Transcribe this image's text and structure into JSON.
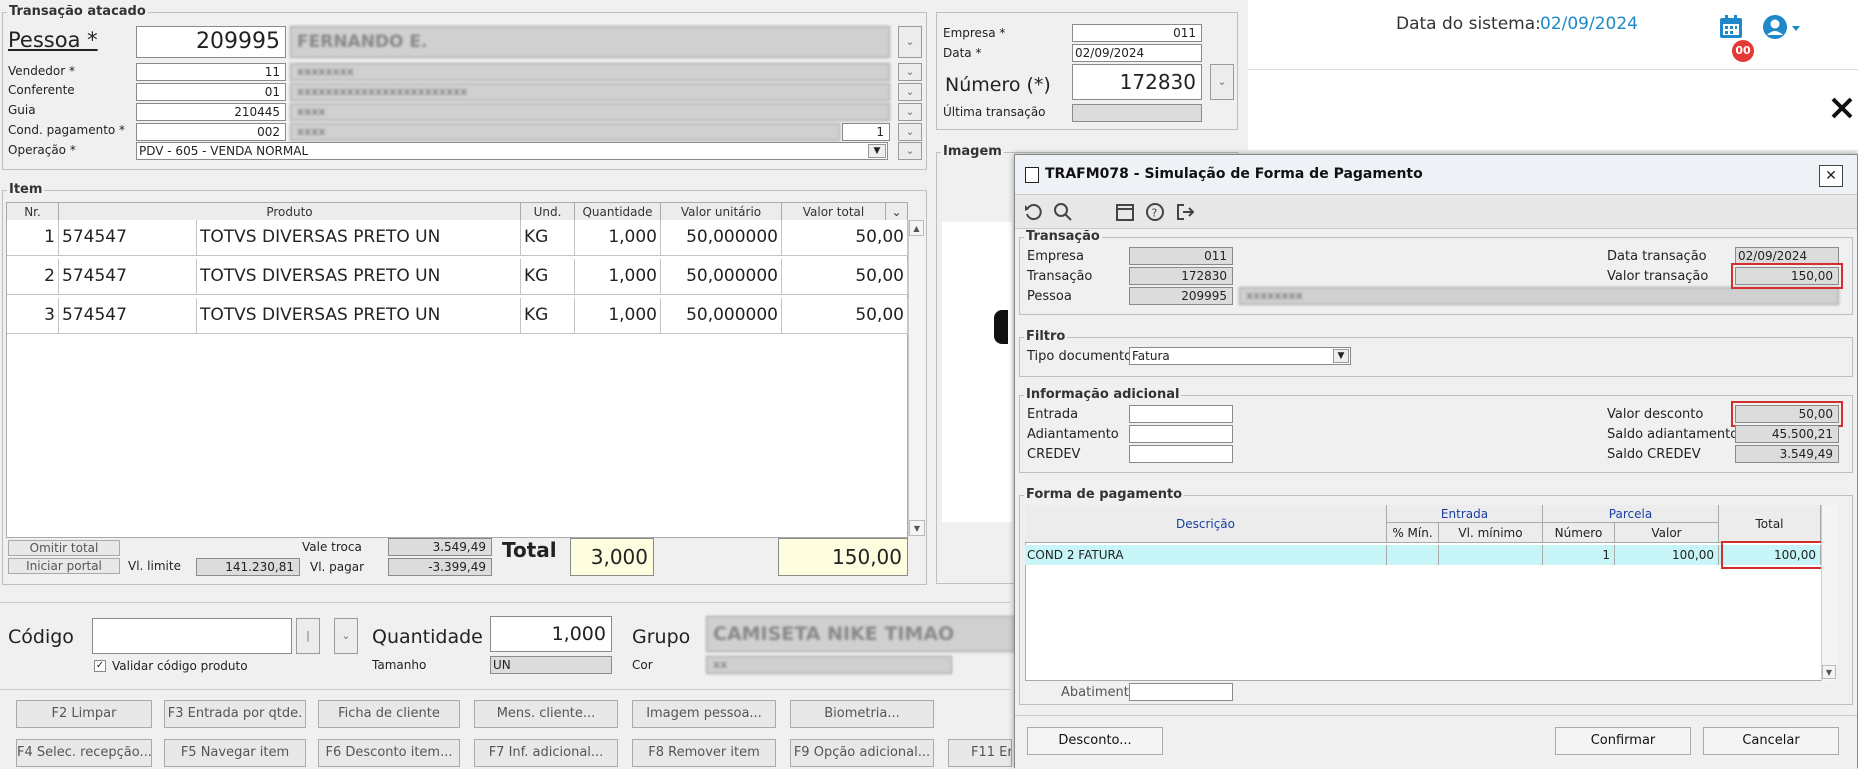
{
  "transacao_atacado": {
    "title": "Transação atacado",
    "pessoa_label": "Pessoa *",
    "pessoa_code": "209995",
    "pessoa_name": "FERNANDO E.",
    "vendedor_label": "Vendedor *",
    "vendedor_code": "11",
    "conferente_label": "Conferente",
    "conferente_code": "01",
    "guia_label": "Guia",
    "guia_code": "210445",
    "cond_label": "Cond. pagamento *",
    "cond_code": "002",
    "cond_num": "1",
    "operacao_label": "Operação *",
    "operacao_value": "PDV - 605 - VENDA NORMAL"
  },
  "empresa_box": {
    "empresa_label": "Empresa *",
    "empresa_value": "011",
    "data_label": "Data *",
    "data_value": "02/09/2024",
    "numero_label": "Número (*)",
    "numero_value": "172830",
    "ultima_label": "Última transação"
  },
  "header": {
    "data_sistema_label": "Data do sistema:",
    "data_sistema_value": "02/09/2024",
    "notif_badge": "00"
  },
  "imagem_label": "Imagem",
  "item": {
    "title": "Item",
    "columns": [
      "Nr.",
      "Produto",
      "Und.",
      "Quantidade",
      "Valor unitário",
      "Valor total"
    ],
    "rows": [
      {
        "nr": "1",
        "code": "574547",
        "produto": "TOTVS DIVERSAS PRETO UN",
        "und": "KG",
        "qtd": "1,000",
        "unit": "50,000000",
        "total": "50,00"
      },
      {
        "nr": "2",
        "code": "574547",
        "produto": "TOTVS DIVERSAS PRETO UN",
        "und": "KG",
        "qtd": "1,000",
        "unit": "50,000000",
        "total": "50,00"
      },
      {
        "nr": "3",
        "code": "574547",
        "produto": "TOTVS DIVERSAS PRETO UN",
        "und": "KG",
        "qtd": "1,000",
        "unit": "50,000000",
        "total": "50,00"
      }
    ]
  },
  "totals": {
    "omitir": "Omitir total",
    "iniciar": "Iniciar portal",
    "vl_limite_label": "Vl. limite",
    "vl_limite": "141.230,81",
    "vale_troca_label": "Vale troca",
    "vale_troca": "3.549,49",
    "vl_pagar_label": "Vl. pagar",
    "vl_pagar": "-3.399,49",
    "total_label": "Total",
    "total_qtd": "3,000",
    "total_valor": "150,00"
  },
  "entry": {
    "codigo_label": "Código",
    "validar_label": "Validar código produto",
    "quantidade_label": "Quantidade",
    "quantidade_value": "1,000",
    "tamanho_label": "Tamanho",
    "tamanho_value": "UN",
    "grupo_label": "Grupo",
    "grupo_value": "CAMISETA NIKE TIMAO",
    "cor_label": "Cor"
  },
  "fbuttons": [
    "F2 Limpar",
    "F3 Entrada por qtde.",
    "Ficha de cliente",
    "Mens. cliente...",
    "Imagem pessoa...",
    "Biometria...",
    "F4 Selec. recepção...",
    "F5 Navegar item",
    "F6 Desconto item...",
    "F7 Inf. adicional...",
    "F8 Remover item",
    "F9 Opção adicional...",
    "F11 Er"
  ],
  "dialog": {
    "title": "TRAFM078 - Simulação de Forma de Pagamento",
    "transacao": {
      "title": "Transação",
      "empresa_label": "Empresa",
      "empresa": "011",
      "transacao_label": "Transação",
      "transacao": "172830",
      "pessoa_label": "Pessoa",
      "pessoa": "209995",
      "data_label": "Data transação",
      "data": "02/09/2024",
      "valor_label": "Valor transação",
      "valor": "150,00"
    },
    "filtro": {
      "title": "Filtro",
      "tipo_label": "Tipo documento",
      "tipo_value": "Fatura"
    },
    "info": {
      "title": "Informação adicional",
      "entrada_label": "Entrada",
      "adiantamento_label": "Adiantamento",
      "credev_label": "CREDEV",
      "desconto_label": "Valor desconto",
      "desconto": "50,00",
      "saldo_adiant_label": "Saldo adiantamento",
      "saldo_adiant": "45.500,21",
      "saldo_credev_label": "Saldo CREDEV",
      "saldo_credev": "3.549,49"
    },
    "forma": {
      "title": "Forma de pagamento",
      "descricao": "Descrição",
      "entrada": "Entrada",
      "parcela": "Parcela",
      "total": "Total",
      "pct_min": "% Mín.",
      "vl_minimo": "Vl. mínimo",
      "numero": "Número",
      "valor": "Valor",
      "row": {
        "descricao": "COND 2 FATURA",
        "pct": "",
        "vlmin": "",
        "numero": "1",
        "valor": "100,00",
        "total": "100,00"
      }
    },
    "abatimento_label": "Abatimento",
    "desconto_btn": "Desconto...",
    "confirmar_btn": "Confirmar",
    "cancelar_btn": "Cancelar"
  },
  "colors": {
    "accent": "#1e88c8",
    "highlight_red": "#d32f2f",
    "row_cyan": "#c8f6f8",
    "total_yellow": "#fffde0"
  }
}
